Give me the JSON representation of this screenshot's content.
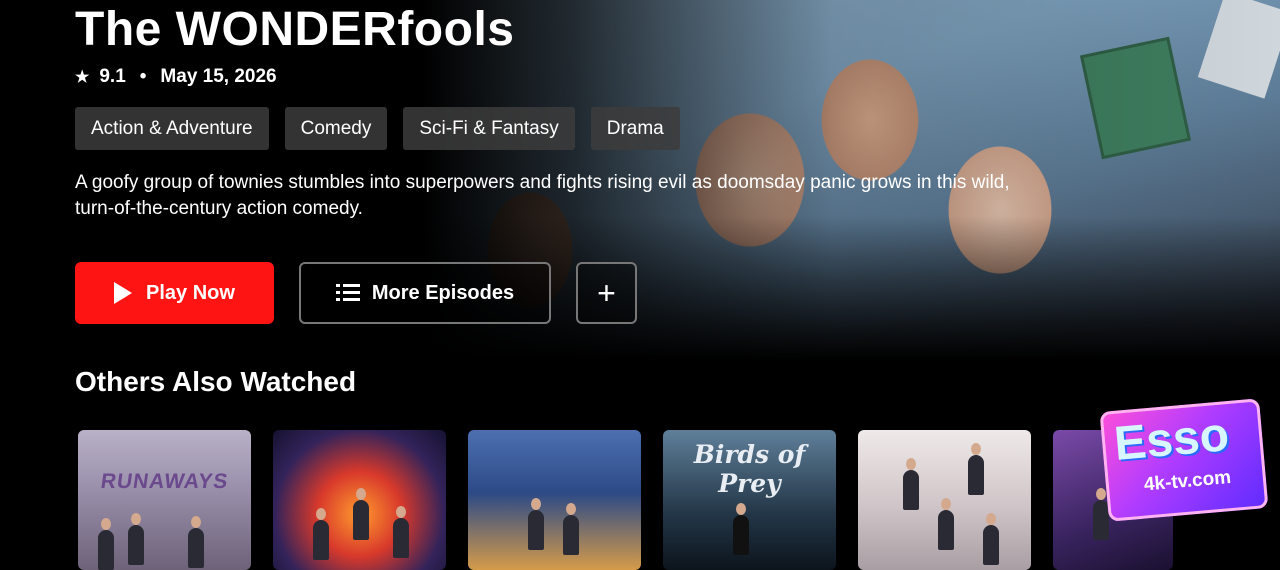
{
  "show": {
    "title": "The WONDERfools",
    "rating_icon": "★",
    "rating": "9.1",
    "separator": "•",
    "date": "May 15, 2026",
    "genres": [
      "Action & Adventure",
      "Comedy",
      "Sci-Fi & Fantasy",
      "Drama"
    ],
    "description": "A goofy group of townies stumbles into superpowers and fights rising evil as doomsday panic grows in this wild, turn-of-the-century action comedy."
  },
  "actions": {
    "play_label": "Play Now",
    "episodes_label": "More Episodes",
    "add_label": "+"
  },
  "others": {
    "title": "Others Also Watched",
    "cards": [
      {
        "label": "RUNAWAYS"
      },
      {
        "label": ""
      },
      {
        "label": ""
      },
      {
        "label": "Birds of Prey"
      },
      {
        "label": ""
      },
      {
        "label": ""
      }
    ]
  },
  "watermark": {
    "brand": "Esso",
    "site": "4k-tv.com"
  },
  "colors": {
    "accent": "#ff1414",
    "background": "#000000",
    "chip": "#3c3c3c"
  }
}
